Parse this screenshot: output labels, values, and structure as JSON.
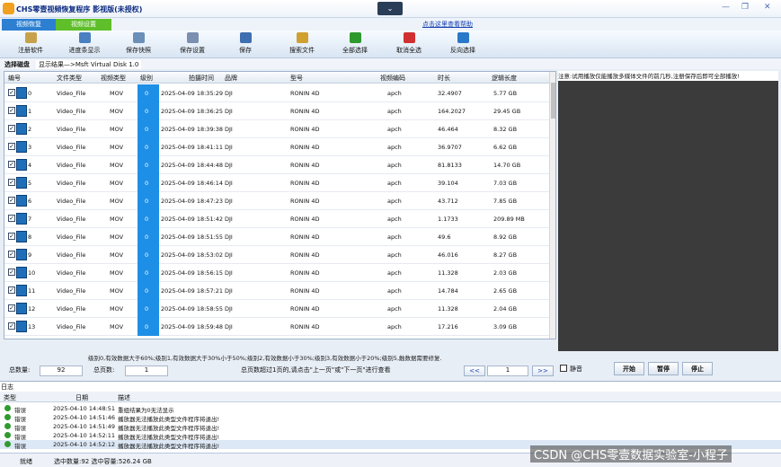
{
  "window": {
    "title": "CHS零壹视频恢复程序 影视版(未授权)",
    "dropdown_glyph": "⌄",
    "controls": [
      "—",
      "❐",
      "✕"
    ]
  },
  "tabs": [
    "视频恢复",
    "视频设置"
  ],
  "hint_link": "点击这里查看帮助",
  "toolbar": [
    {
      "label": "注册软件",
      "icon": "register-icon",
      "color": "#c8a24a"
    },
    {
      "label": "进度条显示",
      "icon": "progress-icon",
      "color": "#4a7fc0"
    },
    {
      "label": "保存快照",
      "icon": "snapshot-icon",
      "color": "#6a8fb8"
    },
    {
      "label": "保存设置",
      "icon": "settings-save-icon",
      "color": "#7b8fb0"
    },
    {
      "label": "保存",
      "icon": "save-icon",
      "color": "#3f6fb0"
    },
    {
      "label": "搜索文件",
      "icon": "search-file-icon",
      "color": "#d0a030"
    },
    {
      "label": "全部选择",
      "icon": "check-all-icon",
      "color": "#2e9a2e"
    },
    {
      "label": "取消全选",
      "icon": "uncheck-all-icon",
      "color": "#d03030"
    },
    {
      "label": "反向选择",
      "icon": "invert-select-icon",
      "color": "#2a78c8"
    }
  ],
  "addressbar": {
    "disk_label": "选择磁盘",
    "path": "显示结果—>Msft   Virtual Disk   1.0"
  },
  "table": {
    "columns": [
      "编号",
      "文件类型",
      "视频类型",
      "级别",
      "拍摄时间",
      "品牌",
      "型号",
      "视频编码",
      "时长",
      "逻辑长度"
    ],
    "rows": [
      [
        "0",
        "Video_File",
        "MOV",
        "0",
        "2025-04-09 18:35:29",
        "DJI",
        "RONIN 4D",
        "apch",
        "32.4907",
        "5.77 GB"
      ],
      [
        "1",
        "Video_File",
        "MOV",
        "0",
        "2025-04-09 18:36:25",
        "DJI",
        "RONIN 4D",
        "apch",
        "164.2027",
        "29.45 GB"
      ],
      [
        "2",
        "Video_File",
        "MOV",
        "0",
        "2025-04-09 18:39:38",
        "DJI",
        "RONIN 4D",
        "apch",
        "46.464",
        "8.32 GB"
      ],
      [
        "3",
        "Video_File",
        "MOV",
        "0",
        "2025-04-09 18:41:11",
        "DJI",
        "RONIN 4D",
        "apch",
        "36.9707",
        "6.62 GB"
      ],
      [
        "4",
        "Video_File",
        "MOV",
        "0",
        "2025-04-09 18:44:48",
        "DJI",
        "RONIN 4D",
        "apch",
        "81.8133",
        "14.70 GB"
      ],
      [
        "5",
        "Video_File",
        "MOV",
        "0",
        "2025-04-09 18:46:14",
        "DJI",
        "RONIN 4D",
        "apch",
        "39.104",
        "7.03 GB"
      ],
      [
        "6",
        "Video_File",
        "MOV",
        "0",
        "2025-04-09 18:47:23",
        "DJI",
        "RONIN 4D",
        "apch",
        "43.712",
        "7.85 GB"
      ],
      [
        "7",
        "Video_File",
        "MOV",
        "0",
        "2025-04-09 18:51:42",
        "DJI",
        "RONIN 4D",
        "apch",
        "1.1733",
        "209.89 MB"
      ],
      [
        "8",
        "Video_File",
        "MOV",
        "0",
        "2025-04-09 18:51:55",
        "DJI",
        "RONIN 4D",
        "apch",
        "49.6",
        "8.92 GB"
      ],
      [
        "9",
        "Video_File",
        "MOV",
        "0",
        "2025-04-09 18:53:02",
        "DJI",
        "RONIN 4D",
        "apch",
        "46.016",
        "8.27 GB"
      ],
      [
        "10",
        "Video_File",
        "MOV",
        "0",
        "2025-04-09 18:56:15",
        "DJI",
        "RONIN 4D",
        "apch",
        "11.328",
        "2.03 GB"
      ],
      [
        "11",
        "Video_File",
        "MOV",
        "0",
        "2025-04-09 18:57:21",
        "DJI",
        "RONIN 4D",
        "apch",
        "14.784",
        "2.65 GB"
      ],
      [
        "12",
        "Video_File",
        "MOV",
        "0",
        "2025-04-09 18:58:55",
        "DJI",
        "RONIN 4D",
        "apch",
        "11.328",
        "2.04 GB"
      ],
      [
        "13",
        "Video_File",
        "MOV",
        "0",
        "2025-04-09 18:59:48",
        "DJI",
        "RONIN 4D",
        "apch",
        "17.216",
        "3.09 GB"
      ]
    ]
  },
  "legend_text": "级别0,有效数据大于60%;级别1,有效数据大于30%小于50%;级别2,有效数据小于30%;级别3,有效数据小于20%;级别5,触数据需要修复.",
  "status": {
    "total_label": "总数量:",
    "total_value": "92",
    "pages_label": "总页数:",
    "pages_value": "1",
    "page_hint": "总页数超过1页的,请点击\"上一页\"或\"下一页\"进行查看",
    "prev": "<<",
    "page_input": "1",
    "next": ">>"
  },
  "preview": {
    "note": "注意:试用播放仅能播放多媒体文件的前几秒,注册保存后即可全部播放!",
    "mute_label": "静音",
    "start": "开始",
    "pause": "暂停",
    "stop": "停止"
  },
  "log": {
    "title": "日志",
    "columns": [
      "类型",
      "日期",
      "描述"
    ],
    "rows": [
      [
        "错误",
        "2025-04-10 14:48:51",
        "重组结果为0无法显示"
      ],
      [
        "错误",
        "2025-04-10 14:51:46",
        "播放器无法播放此类型文件程序将退出!"
      ],
      [
        "错误",
        "2025-04-10 14:51:49",
        "播放器无法播放此类型文件程序将退出!"
      ],
      [
        "错误",
        "2025-04-10 14:52:11",
        "播放器无法播放此类型文件程序将退出!"
      ],
      [
        "错误",
        "2025-04-10 14:52:12",
        "播放器无法播放此类型文件程序将退出!"
      ]
    ]
  },
  "footer": {
    "state": "就绪",
    "summary": "选中数量:92 选中容量:526.24 GB"
  },
  "watermark": "CSDN @CHS零壹数据实验室-小程子"
}
